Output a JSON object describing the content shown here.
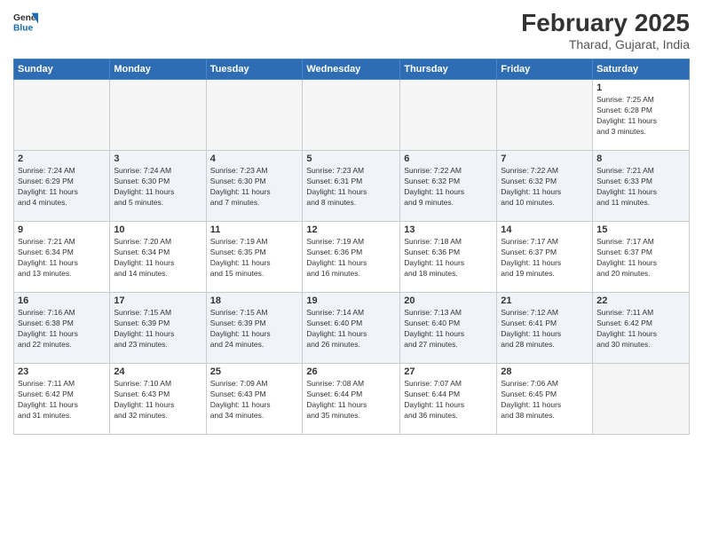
{
  "header": {
    "logo_general": "General",
    "logo_blue": "Blue",
    "main_title": "February 2025",
    "subtitle": "Tharad, Gujarat, India"
  },
  "weekdays": [
    "Sunday",
    "Monday",
    "Tuesday",
    "Wednesday",
    "Thursday",
    "Friday",
    "Saturday"
  ],
  "weeks": [
    [
      {
        "day": "",
        "info": ""
      },
      {
        "day": "",
        "info": ""
      },
      {
        "day": "",
        "info": ""
      },
      {
        "day": "",
        "info": ""
      },
      {
        "day": "",
        "info": ""
      },
      {
        "day": "",
        "info": ""
      },
      {
        "day": "1",
        "info": "Sunrise: 7:25 AM\nSunset: 6:28 PM\nDaylight: 11 hours\nand 3 minutes."
      }
    ],
    [
      {
        "day": "2",
        "info": "Sunrise: 7:24 AM\nSunset: 6:29 PM\nDaylight: 11 hours\nand 4 minutes."
      },
      {
        "day": "3",
        "info": "Sunrise: 7:24 AM\nSunset: 6:30 PM\nDaylight: 11 hours\nand 5 minutes."
      },
      {
        "day": "4",
        "info": "Sunrise: 7:23 AM\nSunset: 6:30 PM\nDaylight: 11 hours\nand 7 minutes."
      },
      {
        "day": "5",
        "info": "Sunrise: 7:23 AM\nSunset: 6:31 PM\nDaylight: 11 hours\nand 8 minutes."
      },
      {
        "day": "6",
        "info": "Sunrise: 7:22 AM\nSunset: 6:32 PM\nDaylight: 11 hours\nand 9 minutes."
      },
      {
        "day": "7",
        "info": "Sunrise: 7:22 AM\nSunset: 6:32 PM\nDaylight: 11 hours\nand 10 minutes."
      },
      {
        "day": "8",
        "info": "Sunrise: 7:21 AM\nSunset: 6:33 PM\nDaylight: 11 hours\nand 11 minutes."
      }
    ],
    [
      {
        "day": "9",
        "info": "Sunrise: 7:21 AM\nSunset: 6:34 PM\nDaylight: 11 hours\nand 13 minutes."
      },
      {
        "day": "10",
        "info": "Sunrise: 7:20 AM\nSunset: 6:34 PM\nDaylight: 11 hours\nand 14 minutes."
      },
      {
        "day": "11",
        "info": "Sunrise: 7:19 AM\nSunset: 6:35 PM\nDaylight: 11 hours\nand 15 minutes."
      },
      {
        "day": "12",
        "info": "Sunrise: 7:19 AM\nSunset: 6:36 PM\nDaylight: 11 hours\nand 16 minutes."
      },
      {
        "day": "13",
        "info": "Sunrise: 7:18 AM\nSunset: 6:36 PM\nDaylight: 11 hours\nand 18 minutes."
      },
      {
        "day": "14",
        "info": "Sunrise: 7:17 AM\nSunset: 6:37 PM\nDaylight: 11 hours\nand 19 minutes."
      },
      {
        "day": "15",
        "info": "Sunrise: 7:17 AM\nSunset: 6:37 PM\nDaylight: 11 hours\nand 20 minutes."
      }
    ],
    [
      {
        "day": "16",
        "info": "Sunrise: 7:16 AM\nSunset: 6:38 PM\nDaylight: 11 hours\nand 22 minutes."
      },
      {
        "day": "17",
        "info": "Sunrise: 7:15 AM\nSunset: 6:39 PM\nDaylight: 11 hours\nand 23 minutes."
      },
      {
        "day": "18",
        "info": "Sunrise: 7:15 AM\nSunset: 6:39 PM\nDaylight: 11 hours\nand 24 minutes."
      },
      {
        "day": "19",
        "info": "Sunrise: 7:14 AM\nSunset: 6:40 PM\nDaylight: 11 hours\nand 26 minutes."
      },
      {
        "day": "20",
        "info": "Sunrise: 7:13 AM\nSunset: 6:40 PM\nDaylight: 11 hours\nand 27 minutes."
      },
      {
        "day": "21",
        "info": "Sunrise: 7:12 AM\nSunset: 6:41 PM\nDaylight: 11 hours\nand 28 minutes."
      },
      {
        "day": "22",
        "info": "Sunrise: 7:11 AM\nSunset: 6:42 PM\nDaylight: 11 hours\nand 30 minutes."
      }
    ],
    [
      {
        "day": "23",
        "info": "Sunrise: 7:11 AM\nSunset: 6:42 PM\nDaylight: 11 hours\nand 31 minutes."
      },
      {
        "day": "24",
        "info": "Sunrise: 7:10 AM\nSunset: 6:43 PM\nDaylight: 11 hours\nand 32 minutes."
      },
      {
        "day": "25",
        "info": "Sunrise: 7:09 AM\nSunset: 6:43 PM\nDaylight: 11 hours\nand 34 minutes."
      },
      {
        "day": "26",
        "info": "Sunrise: 7:08 AM\nSunset: 6:44 PM\nDaylight: 11 hours\nand 35 minutes."
      },
      {
        "day": "27",
        "info": "Sunrise: 7:07 AM\nSunset: 6:44 PM\nDaylight: 11 hours\nand 36 minutes."
      },
      {
        "day": "28",
        "info": "Sunrise: 7:06 AM\nSunset: 6:45 PM\nDaylight: 11 hours\nand 38 minutes."
      },
      {
        "day": "",
        "info": ""
      }
    ]
  ]
}
